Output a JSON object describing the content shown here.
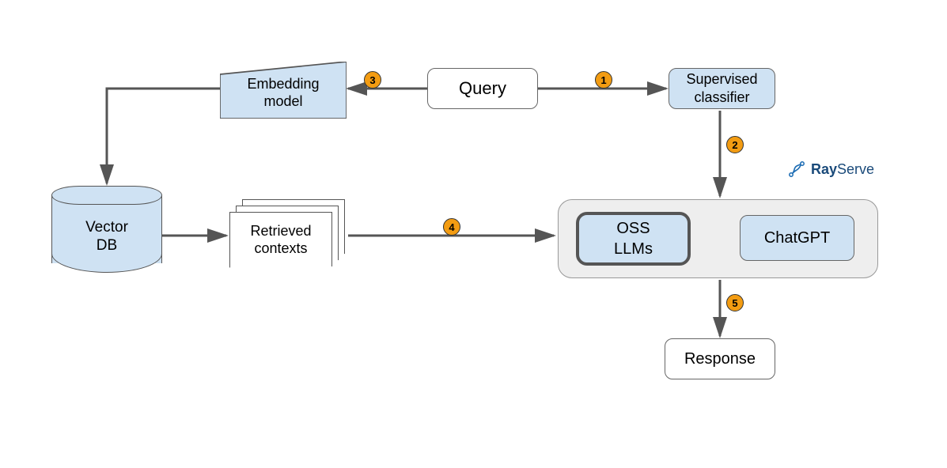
{
  "nodes": {
    "query": "Query",
    "classifier": "Supervised\nclassifier",
    "embedding": "Embedding\nmodel",
    "vector_db": "Vector\nDB",
    "retrieved": "Retrieved\ncontexts",
    "oss_llms": "OSS\nLLMs",
    "chatgpt": "ChatGPT",
    "response": "Response"
  },
  "badges": {
    "b1": "1",
    "b2": "2",
    "b3": "3",
    "b4": "4",
    "b5": "5"
  },
  "brand": {
    "ray": "Ray",
    "serve": "Serve"
  },
  "colors": {
    "blue_fill": "#cfe2f3",
    "gray_fill": "#eeeeee",
    "badge_fill": "#f39c12",
    "arrow": "#555555"
  }
}
